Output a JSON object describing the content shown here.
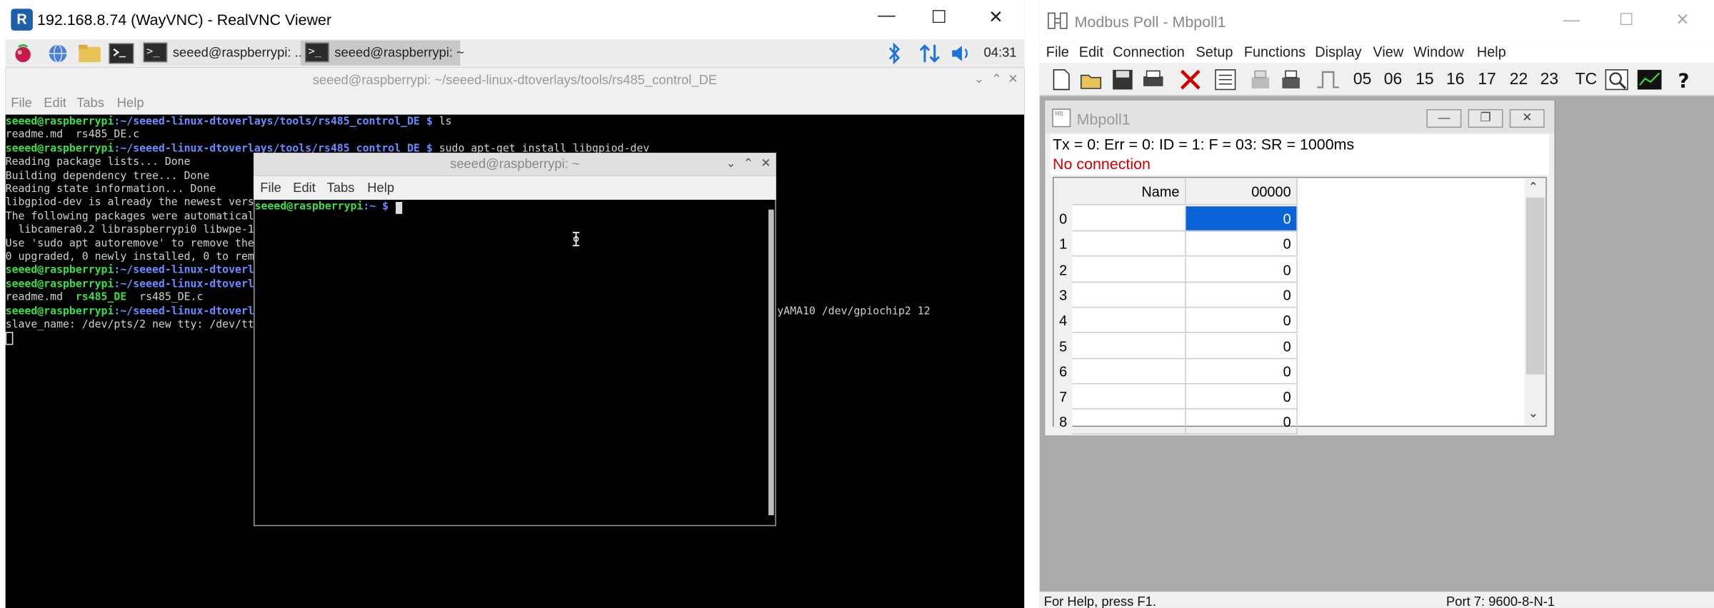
{
  "vnc": {
    "title": "192.168.8.74 (WayVNC) - RealVNC Viewer",
    "minimize": "—",
    "maximize": "☐",
    "close": "✕",
    "taskbar": {
      "task1": "seeed@raspberrypi: ...",
      "task2": "seeed@raspberrypi: ~",
      "clock": "04:31"
    }
  },
  "term_back": {
    "title": "seeed@raspberrypi: ~/seeed-linux-dtoverlays/tools/rs485_control_DE",
    "menu": [
      "File",
      "Edit",
      "Tabs",
      "Help"
    ],
    "controls": {
      "min": "⌄",
      "max": "⌃",
      "close": "✕"
    },
    "prompt_user": "seeed@raspberrypi",
    "path_full": ":~/seeed-linux-dtoverlays/tools/rs485_control_DE $ ",
    "path_trunc": ":~/seeed-linux-dtoverl",
    "cmd_ls": "ls",
    "cmd_install": "sudo apt-get install libgpiod-dev",
    "ls_out": "readme.md  rs485_DE.c",
    "apt1": "Reading package lists... Done",
    "apt2": "Building dependency tree... Done",
    "apt3": "Reading state information... Done",
    "apt4": "libgpiod-dev is already the newest vers",
    "apt5": "The following packages were automatical",
    "apt6": "  libcamera0.2 libraspberrypi0 libwpe-1",
    "apt7": "Use 'sudo apt autoremove' to remove the",
    "apt8": "0 upgraded, 0 newly installed, 0 to rem",
    "ls2_a": "readme.md  ",
    "ls2_b": "rs485_DE",
    "ls2_c": "  rs485_DE.c",
    "run_tail": "yAMA10 /dev/gpiochip2 12",
    "slave": "slave_name: /dev/pts/2 new tty: /dev/tt"
  },
  "term_front": {
    "title": "seeed@raspberrypi: ~",
    "menu": [
      "File",
      "Edit",
      "Tabs",
      "Help"
    ],
    "prompt_user": "seeed@raspberrypi",
    "prompt_path": ":~ $ ",
    "controls": {
      "min": "⌄",
      "max": "⌃",
      "close": "✕"
    }
  },
  "modbus": {
    "title": "Modbus Poll - Mbpoll1",
    "menu": [
      "File",
      "Edit",
      "Connection",
      "Setup",
      "Functions",
      "Display",
      "View",
      "Window",
      "Help"
    ],
    "toolbar_numbers": [
      "05",
      "06",
      "15",
      "16",
      "17",
      "22",
      "23"
    ],
    "toolbar_tc": "TC",
    "child_title": "Mbpoll1",
    "info_line": "Tx = 0: Err = 0: ID = 1: F = 03: SR = 1000ms",
    "connection_status": "No connection",
    "col_name": "Name",
    "col_addr": "00000",
    "rows": [
      {
        "n": "0",
        "v": "0"
      },
      {
        "n": "1",
        "v": "0"
      },
      {
        "n": "2",
        "v": "0"
      },
      {
        "n": "3",
        "v": "0"
      },
      {
        "n": "4",
        "v": "0"
      },
      {
        "n": "5",
        "v": "0"
      },
      {
        "n": "6",
        "v": "0"
      },
      {
        "n": "7",
        "v": "0"
      },
      {
        "n": "8",
        "v": "0"
      }
    ],
    "status_left": "For Help, press F1.",
    "status_right": "Port 7: 9600-8-N-1"
  },
  "colors": {
    "prompt_green": "#3ddc4a",
    "path_blue": "#6b8cff",
    "selection_blue": "#0a63d6",
    "error_red": "#cc0000"
  }
}
